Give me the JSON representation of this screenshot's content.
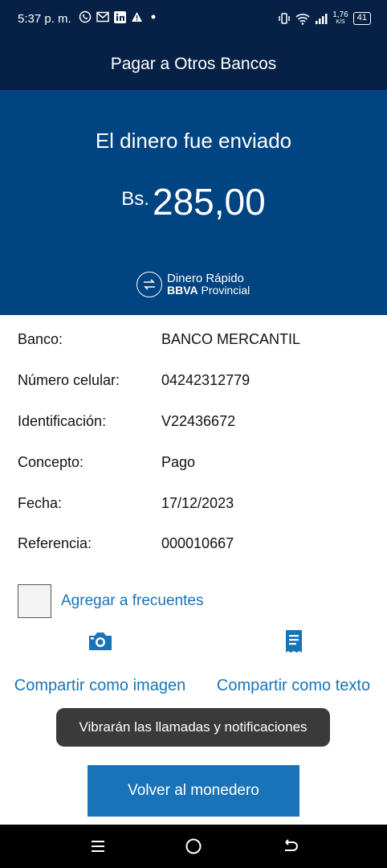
{
  "status_bar": {
    "time": "5:37 p. m.",
    "left_icons": [
      "whatsapp-icon",
      "mail-icon",
      "linkedin-icon",
      "warning-icon",
      "dot-icon"
    ],
    "network_speed": "1,76",
    "network_unit": "K/S",
    "battery": "41"
  },
  "header": {
    "title": "Pagar a Otros Bancos"
  },
  "hero": {
    "title": "El dinero fue enviado",
    "currency": "Bs.",
    "amount": "285,00",
    "brand_line1": "Dinero Rápido",
    "brand_line2_bold": "BBVA",
    "brand_line2_rest": "Provincial"
  },
  "details": [
    {
      "label": "Banco:",
      "value": "BANCO MERCANTIL"
    },
    {
      "label": "Número celular:",
      "value": "04242312779"
    },
    {
      "label": "Identificación:",
      "value": "V22436672"
    },
    {
      "label": "Concepto:",
      "value": "Pago"
    },
    {
      "label": "Fecha:",
      "value": "17/12/2023"
    },
    {
      "label": "Referencia:",
      "value": "000010667"
    }
  ],
  "favorites": {
    "label": "Agregar a frecuentes",
    "checked": false
  },
  "share": {
    "image_label": "Compartir como imagen",
    "text_label": "Compartir como texto"
  },
  "toast": {
    "message": "Vibrarán las llamadas y notificaciones"
  },
  "primary_button": {
    "label": "Volver al monedero"
  },
  "colors": {
    "header_bg": "#072146",
    "hero_bg": "#004481",
    "accent": "#1973b8"
  }
}
